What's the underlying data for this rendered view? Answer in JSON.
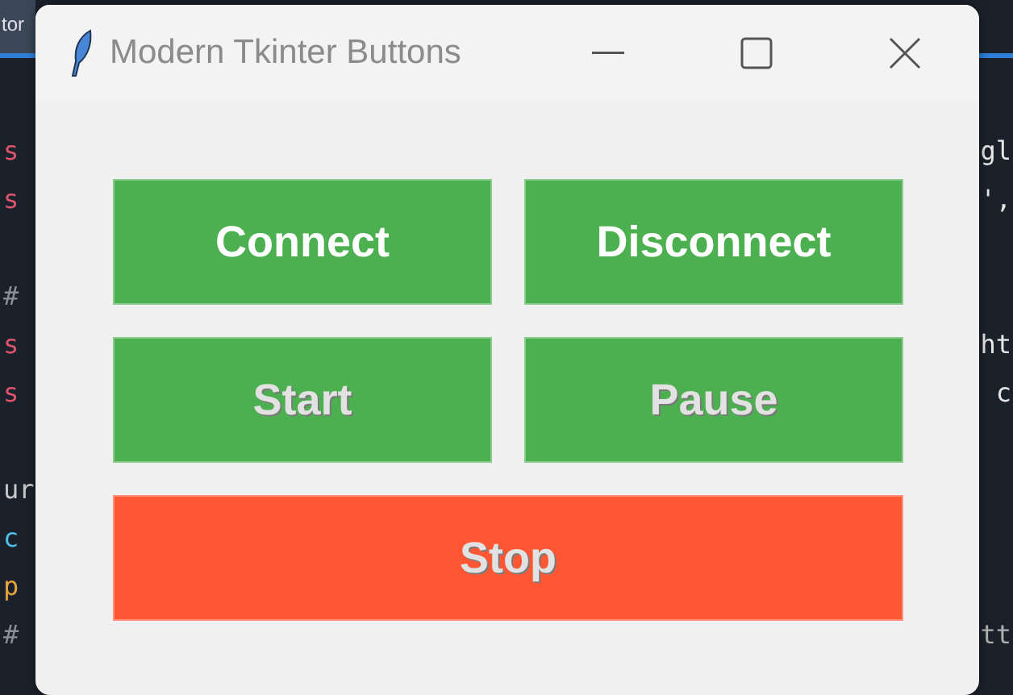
{
  "editor": {
    "tab": {
      "label": "tor"
    },
    "lines": [
      {
        "kind": "code",
        "left": {
          "text": "s",
          "color": "#e0556b"
        },
        "right": {
          "text": "gl",
          "color": "#e6e6e6"
        }
      },
      {
        "kind": "code",
        "left": {
          "text": "s",
          "color": "#e0556b"
        },
        "right": {
          "text": "',",
          "color": "#e6e6e6"
        }
      },
      {
        "kind": "blank"
      },
      {
        "kind": "code",
        "left": {
          "text": "#",
          "color": "#8a8f98"
        }
      },
      {
        "kind": "code",
        "left": {
          "text": "s",
          "color": "#e0556b"
        },
        "right": {
          "text": "ht",
          "color": "#e6e6e6"
        }
      },
      {
        "kind": "code",
        "left": {
          "text": "s",
          "color": "#e0556b"
        },
        "right": {
          "text": "c",
          "color": "#e6e6e6"
        }
      },
      {
        "kind": "blank"
      },
      {
        "kind": "code",
        "left": {
          "text": "ur",
          "color": "#c8c8c8"
        }
      },
      {
        "kind": "code",
        "left": {
          "text": "c",
          "color": "#4fc1e9"
        }
      },
      {
        "kind": "code",
        "left": {
          "text": "p",
          "color": "#e6a23c"
        }
      },
      {
        "kind": "code",
        "left": {
          "text": "#",
          "color": "#8a8f98"
        },
        "right": {
          "text": "tt",
          "color": "#b0b0b0"
        }
      }
    ]
  },
  "window": {
    "title": "Modern Tkinter Buttons"
  },
  "rows": [
    [
      {
        "label": "Connect",
        "color": "#4caf50",
        "disabled": false
      },
      {
        "label": "Disconnect",
        "color": "#4caf50",
        "disabled": false
      }
    ],
    [
      {
        "label": "Start",
        "color": "#4caf50",
        "disabled": true
      },
      {
        "label": "Pause",
        "color": "#4caf50",
        "disabled": true
      }
    ],
    [
      {
        "label": "Stop",
        "color": "#ff5733",
        "disabled": true
      }
    ]
  ]
}
